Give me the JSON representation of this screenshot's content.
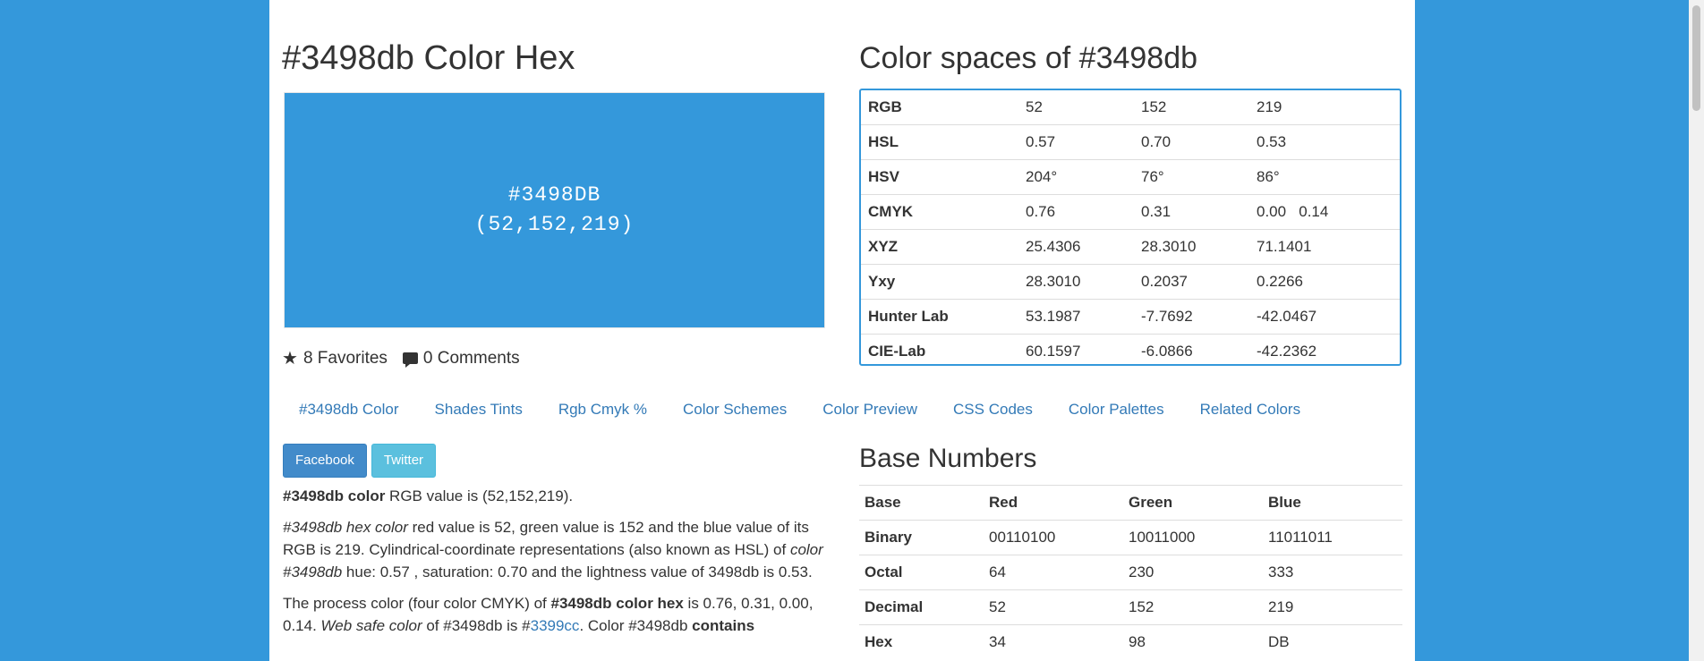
{
  "hex_title": "#3498db Color Hex",
  "swatch": {
    "hex": "#3498DB",
    "rgb": "(52,152,219)",
    "color": "#3498db"
  },
  "meta": {
    "favorites": "8 Favorites",
    "comments": "0 Comments"
  },
  "spaces": {
    "title": "Color spaces of #3498db",
    "rows": [
      {
        "label": "RGB",
        "a": "52",
        "b": "152",
        "c": "219"
      },
      {
        "label": "HSL",
        "a": "0.57",
        "b": "0.70",
        "c": "0.53"
      },
      {
        "label": "HSV",
        "a": "204°",
        "b": "76°",
        "c": "86°"
      },
      {
        "label": "CMYK",
        "a": "0.76",
        "b": "0.31",
        "c": "0.00   0.14"
      },
      {
        "label": "XYZ",
        "a": "25.4306",
        "b": "28.3010",
        "c": "71.1401"
      },
      {
        "label": "Yxy",
        "a": "28.3010",
        "b": "0.2037",
        "c": "0.2266"
      },
      {
        "label": "Hunter Lab",
        "a": "53.1987",
        "b": "-7.7692",
        "c": "-42.0467"
      },
      {
        "label": "CIE-Lab",
        "a": "60.1597",
        "b": "-6.0866",
        "c": "-42.2362"
      }
    ]
  },
  "tabs": [
    "#3498db Color",
    "Shades Tints",
    "Rgb Cmyk %",
    "Color Schemes",
    "Color Preview",
    "CSS Codes",
    "Color Palettes",
    "Related Colors"
  ],
  "share": {
    "facebook": "Facebook",
    "twitter": "Twitter"
  },
  "desc": {
    "p1_bold": "#3498db color",
    "p1_rest": " RGB value is (52,152,219).",
    "p2_em": "#3498db hex color",
    "p2_a": " red value is 52, green value is 152 and the blue value of its RGB is 219. Cylindrical-coordinate representations (also known as HSL) of ",
    "p2_em2": "color #3498db",
    "p2_b": " hue: 0.57 , saturation: 0.70 and the lightness value of 3498db is 0.53.",
    "p3_a": "The process color (four color CMYK) of ",
    "p3_bold": "#3498db color hex",
    "p3_b": " is 0.76, 0.31, 0.00, 0.14. ",
    "p3_em": "Web safe color",
    "p3_c": " of #3498db is #",
    "p3_link": "3399cc",
    "p3_d": ". Color #3498db ",
    "p3_bold2": "contains"
  },
  "base": {
    "title": "Base Numbers",
    "headers": [
      "Base",
      "Red",
      "Green",
      "Blue"
    ],
    "rows": [
      {
        "label": "Binary",
        "r": "00110100",
        "g": "10011000",
        "b": "11011011"
      },
      {
        "label": "Octal",
        "r": "64",
        "g": "230",
        "b": "333"
      },
      {
        "label": "Decimal",
        "r": "52",
        "g": "152",
        "b": "219"
      },
      {
        "label": "Hex",
        "r": "34",
        "g": "98",
        "b": "DB"
      }
    ]
  }
}
